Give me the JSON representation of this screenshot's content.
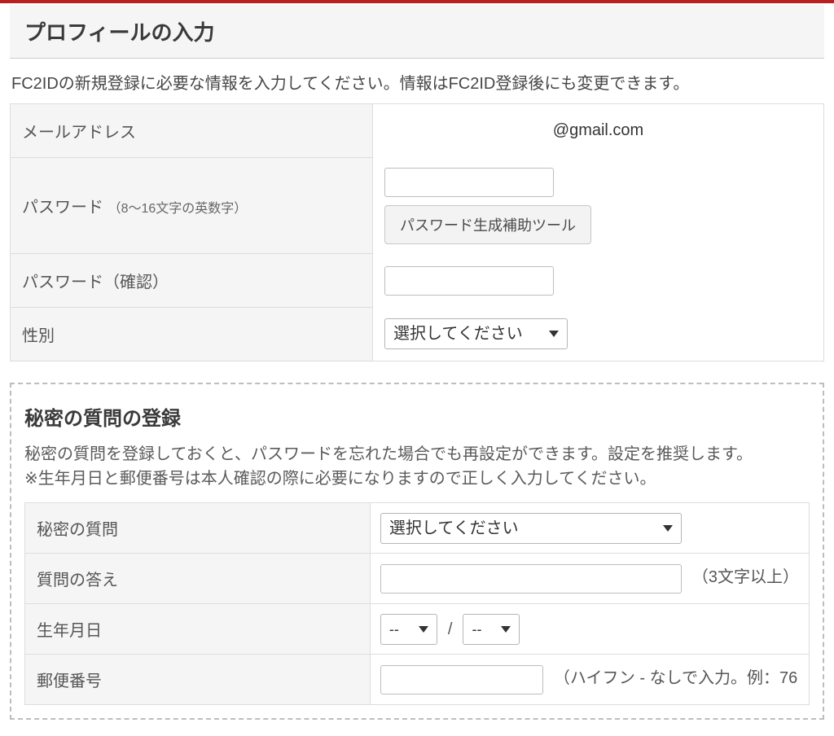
{
  "profile": {
    "title": "プロフィールの入力",
    "intro": "FC2IDの新規登録に必要な情報を入力してください。情報はFC2ID登録後にも変更できます。",
    "rows": {
      "email": {
        "label": "メールアドレス",
        "value": "@gmail.com"
      },
      "password": {
        "label": "パスワード",
        "hint": "（8～16文字の英数字）",
        "gen_button": "パスワード生成補助ツール"
      },
      "password_confirm": {
        "label": "パスワード（確認）"
      },
      "gender": {
        "label": "性別",
        "placeholder": "選択してください"
      }
    }
  },
  "secret": {
    "title": "秘密の質問の登録",
    "desc_line1": "秘密の質問を登録しておくと、パスワードを忘れた場合でも再設定ができます。設定を推奨します。",
    "desc_line2": "※生年月日と郵便番号は本人確認の際に必要になりますので正しく入力してください。",
    "rows": {
      "question": {
        "label": "秘密の質問",
        "placeholder": "選択してください"
      },
      "answer": {
        "label": "質問の答え",
        "note": "（3文字以上）"
      },
      "birthdate": {
        "label": "生年月日",
        "month_placeholder": "--",
        "day_placeholder": "--",
        "separator": "/"
      },
      "postal": {
        "label": "郵便番号",
        "note": "（ハイフン - なしで入力。例：76"
      }
    }
  }
}
